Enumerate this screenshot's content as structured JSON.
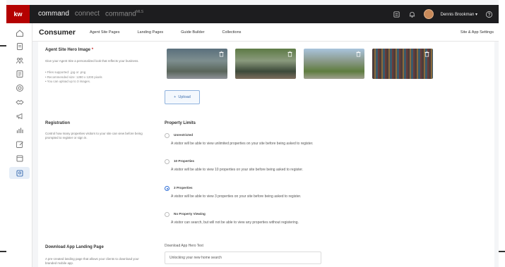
{
  "topbar": {
    "logo": "kw",
    "brand_primary": "command",
    "brand_connect": "connect",
    "brand_mlscommand": "command",
    "brand_mls_sup": "MLS",
    "user_name": "Dennis Brookman",
    "user_caret": "▾",
    "colors": {
      "bar": "#1d1d1f",
      "logo_bg": "#b40101"
    }
  },
  "subheader": {
    "title": "Consumer",
    "nav": [
      "Agent Site Pages",
      "Landing Pages",
      "Guide Builder",
      "Collections"
    ],
    "settings_link": "Site & App Settings"
  },
  "sidebar": {
    "icons": [
      "home-icon",
      "document-icon",
      "people-icon",
      "list-icon",
      "target-icon",
      "handshake-icon",
      "megaphone-icon",
      "chart-icon",
      "edit-icon",
      "window-icon",
      "consumer-icon"
    ],
    "active": "consumer-icon"
  },
  "hero_images": {
    "title": "Agent Site Hero Image",
    "required_mark": "*",
    "description": "Give your Agent Site a personalized look that reflects your business.",
    "bullets": [
      "• Files supported: .jpg or .png",
      "• Recommended size: 1280 x 1200 pixels",
      "• You can upload up to 3 images."
    ],
    "upload_label": "Upload",
    "upload_icon": "+"
  },
  "registration": {
    "title": "Registration",
    "description": "Control how many properties visitors to your site can view before being prompted to register or sign in.",
    "limits_title": "Property Limits",
    "options": [
      {
        "label": "Unrestricted",
        "desc": "A visitor will be able to view unlimited properties on your site before being asked to register.",
        "selected": false
      },
      {
        "label": "10 Properties",
        "desc": "A visitor will be able to view 10 properties on your site before being asked to register.",
        "selected": false
      },
      {
        "label": "3 Properties",
        "desc": "A visitor will be able to view 3 properties on your site before being asked to register.",
        "selected": true
      },
      {
        "label": "No Property Viewing",
        "desc": "A visitor can search, but will not be able to view any properties without registering.",
        "selected": false
      }
    ]
  },
  "download_app": {
    "title": "Download App Landing Page",
    "description": "A pre-created landing page that allows your clients to download your branded mobile app.",
    "hero_text_label": "Download App Hero Text",
    "hero_text_value": "Unlocking your new home search"
  }
}
